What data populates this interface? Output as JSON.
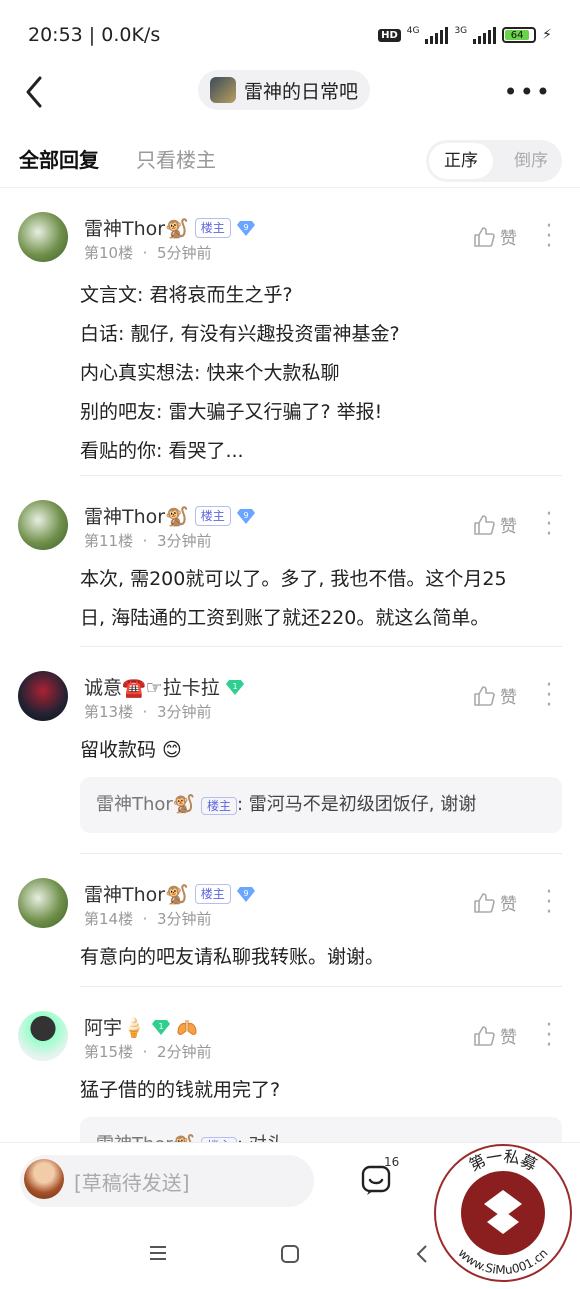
{
  "status_bar": {
    "time": "20:53 | 0.0K/s",
    "network_a": "4G",
    "network_b": "3G",
    "battery": "64"
  },
  "nav": {
    "forum_name": "雷神的日常吧"
  },
  "tabs": {
    "all": "全部回复",
    "op_only": "只看楼主",
    "sort_asc": "正序",
    "sort_desc": "倒序"
  },
  "posts": [
    {
      "name": "雷神Thor🐒",
      "badge": "楼主",
      "gem_level": "9",
      "floor": "第10楼",
      "time": "5分钟前",
      "like": "赞",
      "lines": [
        "文言文: 君将哀而生之乎?",
        "白话: 靓仔, 有没有兴趣投资雷神基金?",
        "内心真实想法: 快来个大款私聊",
        "别的吧友: 雷大骗子又行骗了? 举报!",
        "看贴的你: 看哭了..."
      ]
    },
    {
      "name": "雷神Thor🐒",
      "badge": "楼主",
      "gem_level": "9",
      "floor": "第11楼",
      "time": "3分钟前",
      "like": "赞",
      "lines": [
        "本次, 需200就可以了。多了, 我也不借。这个月25",
        "日, 海陆通的工资到账了就还220。就这么简单。"
      ]
    },
    {
      "name": "诚意☎️☞拉卡拉",
      "badge": "",
      "gem_level": "1",
      "floor": "第13楼",
      "time": "3分钟前",
      "like": "赞",
      "lines": [
        "留收款码 😊"
      ],
      "quote": {
        "name": "雷神Thor🐒",
        "badge": "楼主",
        "text": ": 雷河马不是初级团饭仔, 谢谢"
      }
    },
    {
      "name": "雷神Thor🐒",
      "badge": "楼主",
      "gem_level": "9",
      "floor": "第14楼",
      "time": "3分钟前",
      "like": "赞",
      "lines": [
        "有意向的吧友请私聊我转账。谢谢。"
      ]
    },
    {
      "name": "阿宇🍦",
      "badge": "",
      "gem_level": "1",
      "floor": "第15楼",
      "time": "2分钟前",
      "like": "赞",
      "lines": [
        "猛子借的的钱就用完了?"
      ],
      "quote": {
        "name": "雷神Thor🐒",
        "badge": "楼主",
        "text": ": 对头"
      }
    }
  ],
  "bottom": {
    "draft_placeholder": "[草稿待发送]",
    "emoji_count": "16"
  },
  "watermark": {
    "text": "第一私募",
    "url": "www.SiMu001.cn"
  },
  "colors": {
    "badge": "#5b66e0",
    "gem_blue": "#6aa6ff",
    "gem_green": "#2fcf8f",
    "battery": "#6bd34a"
  }
}
